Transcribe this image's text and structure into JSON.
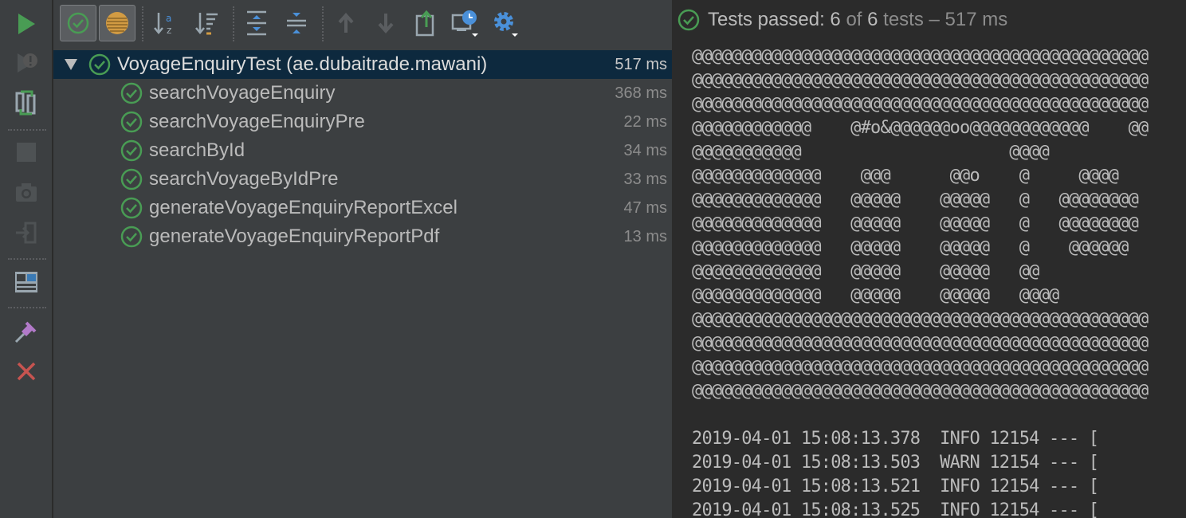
{
  "left_toolbar": {
    "items": [
      {
        "name": "rerun-icon"
      },
      {
        "name": "rerun-failed-icon"
      },
      {
        "name": "toggle-auto-test-icon"
      },
      {
        "name": "stop-icon"
      },
      {
        "name": "dump-threads-icon"
      },
      {
        "name": "export-icon"
      },
      {
        "name": "layout-icon"
      },
      {
        "name": "pin-tab-icon"
      },
      {
        "name": "close-icon"
      }
    ]
  },
  "top_toolbar": {
    "items": [
      {
        "name": "show-passed-icon",
        "toggled": true
      },
      {
        "name": "show-ignored-icon",
        "toggled": true
      },
      {
        "name": "sort-alphabetically-icon"
      },
      {
        "name": "sort-by-duration-icon"
      },
      {
        "name": "expand-all-icon"
      },
      {
        "name": "collapse-all-icon"
      },
      {
        "name": "previous-failed-icon"
      },
      {
        "name": "next-failed-icon"
      },
      {
        "name": "export-results-icon"
      },
      {
        "name": "test-history-icon"
      },
      {
        "name": "settings-icon"
      }
    ]
  },
  "tree": {
    "root": {
      "label": "VoyageEnquiryTest (ae.dubaitrade.mawani)",
      "time": "517 ms"
    },
    "children": [
      {
        "label": "searchVoyageEnquiry",
        "time": "368 ms"
      },
      {
        "label": "searchVoyageEnquiryPre",
        "time": "22 ms"
      },
      {
        "label": "searchById",
        "time": "34 ms"
      },
      {
        "label": "searchVoyageByIdPre",
        "time": "33 ms"
      },
      {
        "label": "generateVoyageEnquiryReportExcel",
        "time": "47 ms"
      },
      {
        "label": "generateVoyageEnquiryReportPdf",
        "time": "13 ms"
      }
    ]
  },
  "status": {
    "prefix": "Tests passed: ",
    "passed": "6",
    "of": " of ",
    "total": "6",
    "suffix": " tests",
    "dash": " – ",
    "duration": "517 ms"
  },
  "console": {
    "lines": [
      "@@@@@@@@@@@@@@@@@@@@@@@@@@@@@@@@@@@@@@@@@@@@@@",
      "@@@@@@@@@@@@@@@@@@@@@@@@@@@@@@@@@@@@@@@@@@@@@@",
      "@@@@@@@@@@@@@@@@@@@@@@@@@@@@@@@@@@@@@@@@@@@@@@",
      "@@@@@@@@@@@@    @#o&@@@@@@oo@@@@@@@@@@@@    @@",
      "@@@@@@@@@@@                     @@@@",
      "@@@@@@@@@@@@@    @@@      @@o    @     @@@@",
      "@@@@@@@@@@@@@   @@@@@    @@@@@   @   @@@@@@@@",
      "@@@@@@@@@@@@@   @@@@@    @@@@@   @   @@@@@@@@",
      "@@@@@@@@@@@@@   @@@@@    @@@@@   @    @@@@@@",
      "@@@@@@@@@@@@@   @@@@@    @@@@@   @@",
      "@@@@@@@@@@@@@   @@@@@    @@@@@   @@@@",
      "@@@@@@@@@@@@@@@@@@@@@@@@@@@@@@@@@@@@@@@@@@@@@@",
      "@@@@@@@@@@@@@@@@@@@@@@@@@@@@@@@@@@@@@@@@@@@@@@",
      "@@@@@@@@@@@@@@@@@@@@@@@@@@@@@@@@@@@@@@@@@@@@@@",
      "@@@@@@@@@@@@@@@@@@@@@@@@@@@@@@@@@@@@@@@@@@@@@@",
      "",
      "2019-04-01 15:08:13.378  INFO 12154 --- [",
      "2019-04-01 15:08:13.503  WARN 12154 --- [",
      "2019-04-01 15:08:13.521  INFO 12154 --- [",
      "2019-04-01 15:08:13.525  INFO 12154 --- ["
    ]
  },
  "colors": {
    "pass_green": "#499c54",
    "run_green": "#499c54",
    "selection": "#0d293e",
    "close_red": "#c75450"
  }
}
